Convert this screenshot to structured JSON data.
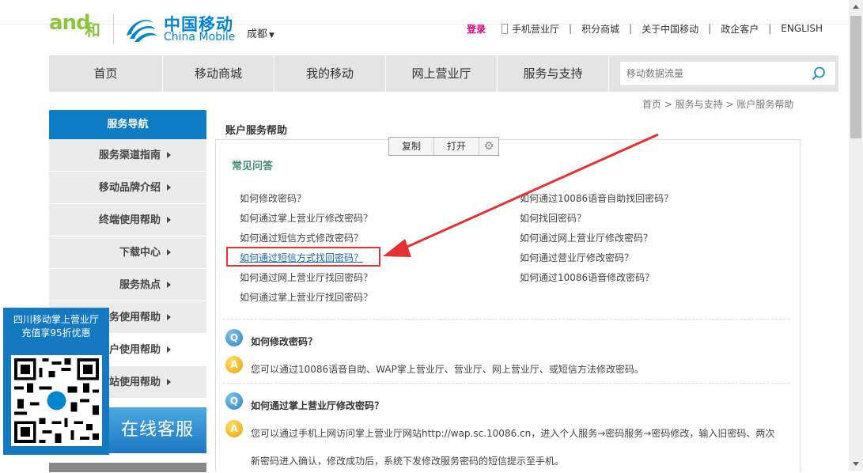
{
  "header": {
    "logo_and": "and",
    "logo_he": "和",
    "cm_cn": "中国移动",
    "cm_en": "China Mobile",
    "city": "成都",
    "login": "登录",
    "links": [
      "手机营业厅",
      "积分商城",
      "关于中国移动",
      "政企客户",
      "ENGLISH"
    ]
  },
  "nav": {
    "items": [
      "首页",
      "移动商城",
      "我的移动",
      "网上营业厅",
      "服务与支持"
    ],
    "search_placeholder": "移动数据流量"
  },
  "breadcrumb": "首页 > 服务与支持 > 账户服务帮助",
  "sidebar": {
    "title": "服务导航",
    "items": [
      "服务渠道指南",
      "移动品牌介绍",
      "终端使用帮助",
      "下载中心",
      "服务热点",
      "业务使用帮助",
      "账户使用帮助",
      "网站使用帮助"
    ],
    "online_service": "在线客服"
  },
  "promo": {
    "line1": "四川移动掌上营业厅",
    "line2": "充值享95折优惠"
  },
  "main": {
    "title": "账户服务帮助",
    "faq_title": "常见问答",
    "questions_left": [
      "如何修改密码？",
      "如何通过掌上营业厅修改密码？",
      "如何通过短信方式修改密码？",
      "如何通过短信方式找回密码？",
      "如何通过网上营业厅找回密码？",
      "如何通过掌上营业厅找回密码？"
    ],
    "questions_right": [
      "如何通过10086语音自助找回密码？",
      "如何找回密码？",
      "如何通过网上营业厅修改密码？",
      "如何通过营业厅修改密码？",
      "如何通过10086语音修改密码？"
    ],
    "qa": [
      {
        "q": "如何修改密码？",
        "a": [
          "您可以通过10086语音自助、WAP掌上营业厅、营业厅、网上营业厅、或短信方法修改密码。"
        ]
      },
      {
        "q": "如何通过掌上营业厅修改密码？",
        "a": [
          "您可以通过手机上网访问掌上营业厅网站http://wap.sc.10086.cn，进入个人服务→密码服务→密码修改，输入旧密码、两次",
          "新密码进入确认，修改成功后，系统下发修改服务密码的短信提示至手机。"
        ]
      }
    ],
    "q_badge": "Q",
    "a_badge": "A"
  },
  "popup": {
    "copy": "复制",
    "open": "打开"
  },
  "colors": {
    "brand_blue": "#0f7cc6",
    "highlight_red": "#e53131",
    "login_pink": "#e4007f"
  }
}
